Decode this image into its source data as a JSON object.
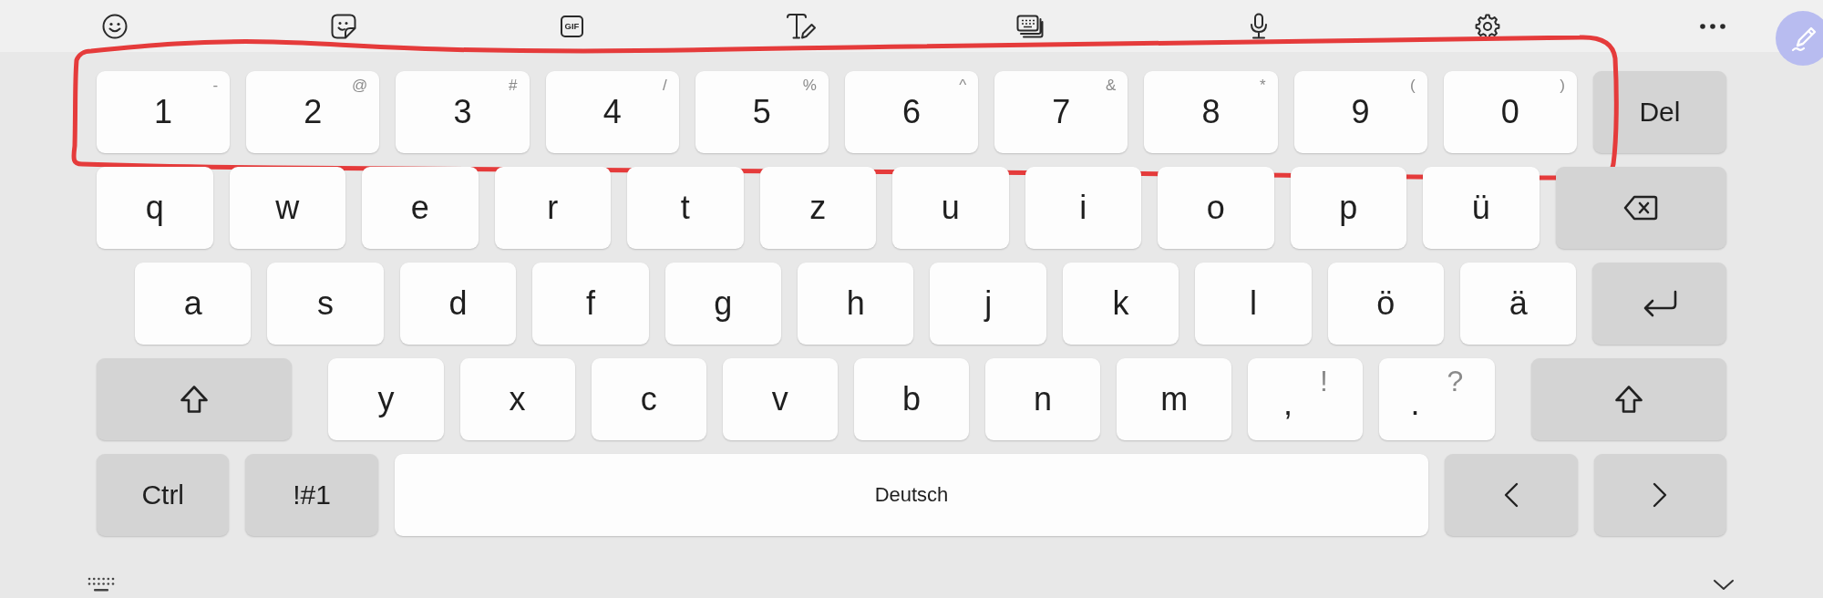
{
  "toolbar": {
    "gif_label": "GIF"
  },
  "rows": [
    {
      "highlighted": true,
      "keys": [
        {
          "kind": "digit",
          "label": "1",
          "hint": "-"
        },
        {
          "kind": "digit",
          "label": "2",
          "hint": "@"
        },
        {
          "kind": "digit",
          "label": "3",
          "hint": "#"
        },
        {
          "kind": "digit",
          "label": "4",
          "hint": "/"
        },
        {
          "kind": "digit",
          "label": "5",
          "hint": "%"
        },
        {
          "kind": "digit",
          "label": "6",
          "hint": "^"
        },
        {
          "kind": "digit",
          "label": "7",
          "hint": "&"
        },
        {
          "kind": "digit",
          "label": "8",
          "hint": "*"
        },
        {
          "kind": "digit",
          "label": "9",
          "hint": "("
        },
        {
          "kind": "digit",
          "label": "0",
          "hint": ")"
        },
        {
          "kind": "func",
          "label": "Del"
        }
      ]
    },
    {
      "highlighted": false,
      "keys": [
        {
          "kind": "letter",
          "label": "q"
        },
        {
          "kind": "letter",
          "label": "w"
        },
        {
          "kind": "letter",
          "label": "e"
        },
        {
          "kind": "letter",
          "label": "r"
        },
        {
          "kind": "letter",
          "label": "t"
        },
        {
          "kind": "letter",
          "label": "z"
        },
        {
          "kind": "letter",
          "label": "u"
        },
        {
          "kind": "letter",
          "label": "i"
        },
        {
          "kind": "letter",
          "label": "o"
        },
        {
          "kind": "letter",
          "label": "p"
        },
        {
          "kind": "letter",
          "label": "ü"
        },
        {
          "kind": "backspace"
        }
      ]
    },
    {
      "highlighted": false,
      "keys": [
        {
          "kind": "letter",
          "label": "a"
        },
        {
          "kind": "letter",
          "label": "s"
        },
        {
          "kind": "letter",
          "label": "d"
        },
        {
          "kind": "letter",
          "label": "f"
        },
        {
          "kind": "letter",
          "label": "g"
        },
        {
          "kind": "letter",
          "label": "h"
        },
        {
          "kind": "letter",
          "label": "j"
        },
        {
          "kind": "letter",
          "label": "k"
        },
        {
          "kind": "letter",
          "label": "l"
        },
        {
          "kind": "letter",
          "label": "ö"
        },
        {
          "kind": "letter",
          "label": "ä"
        },
        {
          "kind": "enter"
        }
      ]
    },
    {
      "highlighted": false,
      "keys": [
        {
          "kind": "shift"
        },
        {
          "kind": "letter",
          "label": "y"
        },
        {
          "kind": "letter",
          "label": "x"
        },
        {
          "kind": "letter",
          "label": "c"
        },
        {
          "kind": "letter",
          "label": "v"
        },
        {
          "kind": "letter",
          "label": "b"
        },
        {
          "kind": "letter",
          "label": "n"
        },
        {
          "kind": "letter",
          "label": "m"
        },
        {
          "kind": "punct",
          "label": ",",
          "hint": "!"
        },
        {
          "kind": "punct",
          "label": ".",
          "hint": "?"
        },
        {
          "kind": "shift"
        }
      ]
    },
    {
      "highlighted": false,
      "keys": [
        {
          "kind": "func",
          "label": "Ctrl"
        },
        {
          "kind": "func",
          "label": "!#1"
        },
        {
          "kind": "space",
          "label": "Deutsch"
        },
        {
          "kind": "left"
        },
        {
          "kind": "right"
        }
      ]
    }
  ]
}
